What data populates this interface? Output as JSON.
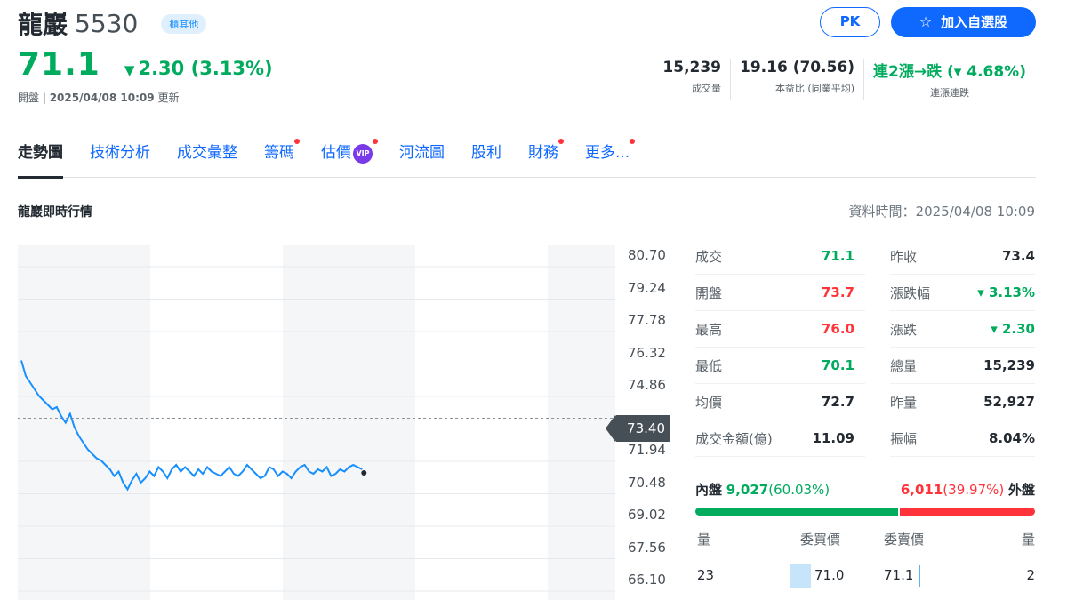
{
  "header": {
    "name": "龍巖",
    "code": "5530",
    "market_badge": "櫃其他",
    "pk_label": "PK",
    "add_label": "加入自選股"
  },
  "price": {
    "last": "71.1",
    "change": "2.30",
    "change_pct": "(3.13%)",
    "status_prefix": "開盤 | ",
    "timestamp": "2025/04/08 10:09",
    "status_suffix": " 更新"
  },
  "stats": {
    "volume": "15,239",
    "volume_label": "成交量",
    "pe": "19.16 (70.56)",
    "pe_label": "本益比 (同業平均)",
    "streak": "連2漲→跌 (▾ 4.68%)",
    "streak_label": "連漲連跌"
  },
  "tabs": [
    {
      "label": "走勢圖",
      "active": true,
      "dot": false
    },
    {
      "label": "技術分析",
      "active": false,
      "dot": false
    },
    {
      "label": "成交彙整",
      "active": false,
      "dot": false
    },
    {
      "label": "籌碼",
      "active": false,
      "dot": true
    },
    {
      "label": "估價",
      "active": false,
      "dot": true,
      "vip": "VIP"
    },
    {
      "label": "河流圖",
      "active": false,
      "dot": false
    },
    {
      "label": "股利",
      "active": false,
      "dot": false
    },
    {
      "label": "財務",
      "active": false,
      "dot": true
    },
    {
      "label": "更多...",
      "active": false,
      "dot": true
    }
  ],
  "section": {
    "title": "龍巖即時行情",
    "data_time": "資料時間：2025/04/08 10:09"
  },
  "chart_data": {
    "type": "line",
    "title": "",
    "y_ticks": [
      "80.70",
      "79.24",
      "77.78",
      "76.32",
      "74.86",
      "73.40",
      "71.94",
      "70.48",
      "69.02",
      "67.56",
      "66.10"
    ],
    "ylim": [
      66.1,
      80.7
    ],
    "prev_close": "73.40",
    "series": [
      {
        "values": [
          76.0,
          75.3,
          75.0,
          74.7,
          74.4,
          74.2,
          74.0,
          73.8,
          73.9,
          73.5,
          73.2,
          73.6,
          73.0,
          72.6,
          72.3,
          72.0,
          71.8,
          71.6,
          71.5,
          71.3,
          71.1,
          70.8,
          71.0,
          70.5,
          70.2,
          70.6,
          70.9,
          70.5,
          70.7,
          71.0,
          70.8,
          71.2,
          71.0,
          70.7,
          71.1,
          71.3,
          71.0,
          71.2,
          71.0,
          70.8,
          71.1,
          70.9,
          71.2,
          71.0,
          70.9,
          70.8,
          71.0,
          71.2,
          70.9,
          70.8,
          71.0,
          71.3,
          71.1,
          70.9,
          70.7,
          70.8,
          71.2,
          71.1,
          70.8,
          71.0,
          70.9,
          70.7,
          71.0,
          71.2,
          71.3,
          71.0,
          70.9,
          71.1,
          71.0,
          71.2,
          70.8,
          70.9,
          71.1,
          71.0,
          71.2,
          71.3,
          71.2,
          71.1
        ]
      }
    ],
    "total_minutes": 270
  },
  "quote": {
    "rows": [
      {
        "l1": "成交",
        "v1": "71.1",
        "c1": "down",
        "l2": "昨收",
        "v2": "73.4",
        "c2": "flat"
      },
      {
        "l1": "開盤",
        "v1": "73.7",
        "c1": "up",
        "l2": "漲跌幅",
        "v2": "▾ 3.13%",
        "c2": "down"
      },
      {
        "l1": "最高",
        "v1": "76.0",
        "c1": "up",
        "l2": "漲跌",
        "v2": "▾ 2.30",
        "c2": "down"
      },
      {
        "l1": "最低",
        "v1": "70.1",
        "c1": "down",
        "l2": "總量",
        "v2": "15,239",
        "c2": "flat"
      },
      {
        "l1": "均價",
        "v1": "72.7",
        "c1": "flat",
        "l2": "昨量",
        "v2": "52,927",
        "c2": "flat"
      },
      {
        "l1": "成交金額(億)",
        "v1": "11.09",
        "c1": "flat",
        "l2": "振幅",
        "v2": "8.04%",
        "c2": "flat"
      }
    ]
  },
  "inout": {
    "in_label": "內盤",
    "in_value": "9,027",
    "in_pct": "(60.03%)",
    "in_ratio": 0.6003,
    "out_value": "6,011",
    "out_pct": "(39.97%)",
    "out_label": "外盤"
  },
  "orderbook": {
    "headers": [
      "量",
      "委買價",
      "委賣價",
      "量"
    ],
    "row": {
      "bid_qty": "23",
      "bid_price": "71.0",
      "ask_price": "71.1",
      "ask_qty": "2"
    }
  },
  "colors": {
    "up": "#ff333a",
    "down": "#00ab5e",
    "accent": "#0f69ff",
    "line": "#188fff"
  }
}
